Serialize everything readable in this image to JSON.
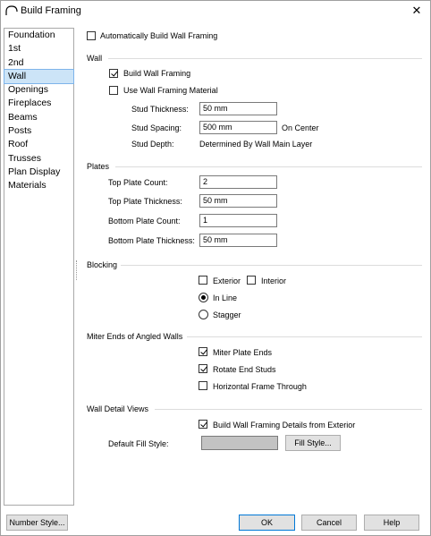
{
  "window": {
    "title": "Build Framing",
    "close_glyph": "✕"
  },
  "sidebar": {
    "items": [
      {
        "label": "Foundation",
        "selected": false
      },
      {
        "label": "1st",
        "selected": false
      },
      {
        "label": "2nd",
        "selected": false
      },
      {
        "label": "Wall",
        "selected": true
      },
      {
        "label": "Openings",
        "selected": false
      },
      {
        "label": "Fireplaces",
        "selected": false
      },
      {
        "label": "Beams",
        "selected": false
      },
      {
        "label": "Posts",
        "selected": false
      },
      {
        "label": "Roof",
        "selected": false
      },
      {
        "label": "Trusses",
        "selected": false
      },
      {
        "label": "Plan Display",
        "selected": false
      },
      {
        "label": "Materials",
        "selected": false
      }
    ]
  },
  "auto_build": {
    "label": "Automatically Build Wall Framing",
    "checked": false
  },
  "wall": {
    "title": "Wall",
    "build_wall_framing": {
      "label": "Build Wall Framing",
      "checked": true
    },
    "use_material": {
      "label": "Use Wall Framing Material",
      "checked": false
    },
    "stud_thickness": {
      "label": "Stud Thickness:",
      "value": "50 mm"
    },
    "stud_spacing": {
      "label": "Stud Spacing:",
      "value": "500 mm",
      "suffix": "On Center"
    },
    "stud_depth": {
      "label": "Stud Depth:",
      "value": "Determined By Wall Main Layer"
    }
  },
  "plates": {
    "title": "Plates",
    "top_count": {
      "label": "Top Plate Count:",
      "value": "2"
    },
    "top_thickness": {
      "label": "Top Plate Thickness:",
      "value": "50 mm"
    },
    "bottom_count": {
      "label": "Bottom Plate Count:",
      "value": "1"
    },
    "bottom_thickness": {
      "label": "Bottom Plate Thickness:",
      "value": "50 mm"
    }
  },
  "blocking": {
    "title": "Blocking",
    "exterior": {
      "label": "Exterior",
      "checked": false
    },
    "interior": {
      "label": "Interior",
      "checked": false
    },
    "in_line": {
      "label": "In Line",
      "selected": true
    },
    "stagger": {
      "label": "Stagger",
      "selected": false
    }
  },
  "miter": {
    "title": "Miter Ends of Angled Walls",
    "miter_plate_ends": {
      "label": "Miter Plate Ends",
      "checked": true
    },
    "rotate_end_studs": {
      "label": "Rotate End Studs",
      "checked": true
    },
    "horizontal_frame": {
      "label": "Horizontal Frame Through",
      "checked": false
    }
  },
  "detail_views": {
    "title": "Wall Detail Views",
    "build_details": {
      "label": "Build Wall Framing Details from Exterior",
      "checked": true
    },
    "fill_style_label": "Default Fill Style:",
    "fill_style_button": "Fill Style...",
    "fill_color": "#c3c3c3"
  },
  "footer": {
    "number_style": "Number Style...",
    "ok": "OK",
    "cancel": "Cancel",
    "help": "Help"
  }
}
